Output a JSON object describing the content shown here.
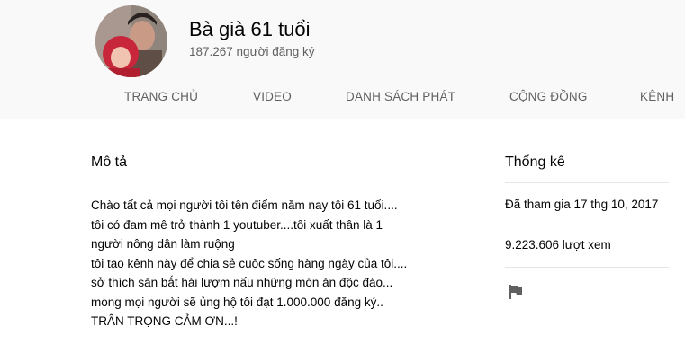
{
  "channel": {
    "name": "Bà già 61 tuổi",
    "subscribers": "187.267 người đăng ký"
  },
  "tabs": [
    {
      "label": "TRANG CHỦ"
    },
    {
      "label": "VIDEO"
    },
    {
      "label": "DANH SÁCH PHÁT"
    },
    {
      "label": "CỘNG ĐỒNG"
    },
    {
      "label": "KÊNH"
    }
  ],
  "about": {
    "description_title": "Mô tả",
    "description": "Chào tất cả mọi người tôi tên điểm năm nay tôi 61 tuổi....\ntôi có đam mê trở thành 1 youtuber....tôi xuất thân là 1\nngười nông dân làm ruộng\ntôi tạo kênh này để chia sẻ cuộc sống hàng ngày của tôi....\nsở thích săn bắt hái lượm nấu những món ăn độc đáo...\nmong mọi người sẽ ủng hộ tôi đạt 1.000.000 đăng ký..\nTRÂN TRỌNG CẢM ƠN...!",
    "stats_title": "Thống kê",
    "joined": "Đã tham gia 17 thg 10, 2017",
    "views": "9.223.606 lượt xem",
    "report_icon": "flag-icon"
  },
  "colors": {
    "header_bg": "#f9f9f9",
    "secondary_text": "#606060",
    "divider": "#e5e5e5"
  }
}
